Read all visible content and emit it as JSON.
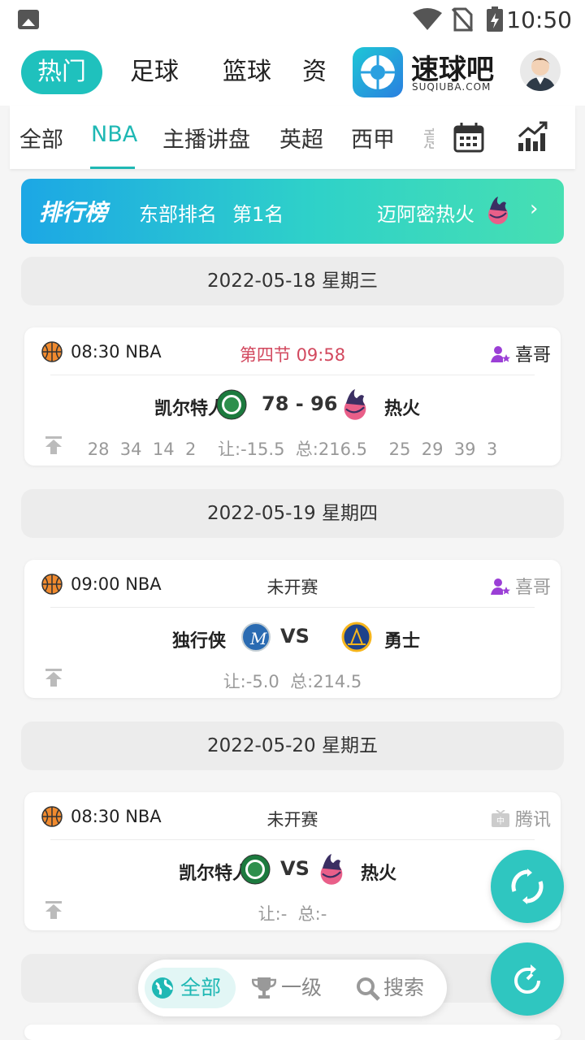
{
  "status_bar": {
    "time": "10:50"
  },
  "top_tabs": [
    {
      "label": "热门",
      "active": true
    },
    {
      "label": "足球",
      "active": false
    },
    {
      "label": "篮球",
      "active": false
    },
    {
      "label": "资讯",
      "active": false
    }
  ],
  "logo": {
    "name": "速球吧",
    "sub": "SUQIUBA.COM"
  },
  "sub_tabs": [
    {
      "label": "全部",
      "active": false
    },
    {
      "label": "NBA",
      "active": true
    },
    {
      "label": "主播讲盘",
      "active": false
    },
    {
      "label": "英超",
      "active": false
    },
    {
      "label": "西甲",
      "active": false
    },
    {
      "label": "意",
      "active": false
    }
  ],
  "banner": {
    "title": "排行榜",
    "conference": "东部排名",
    "rank": "第1名",
    "team": "迈阿密热火",
    "chevron": "›"
  },
  "days": [
    {
      "date": "2022-05-18 星期三",
      "match": {
        "time_league": "08:30 NBA",
        "status": "第四节  09:58",
        "live": true,
        "anchor": "喜哥",
        "anchor_icon": "user-star-icon",
        "home": "凯尔特人",
        "center": "78 - 96",
        "away": "热火",
        "stats": "28  34  14  2    让:-15.5  总:216.5    25  29  39  3"
      }
    },
    {
      "date": "2022-05-19 星期四",
      "match": {
        "time_league": "09:00 NBA",
        "status": "未开赛",
        "live": false,
        "anchor": "喜哥",
        "anchor_icon": "user-star-icon",
        "home": "独行侠",
        "center": "VS",
        "away": "勇士",
        "stats": "让:-5.0  总:214.5"
      }
    },
    {
      "date": "2022-05-20 星期五",
      "match": {
        "time_league": "08:30 NBA",
        "status": "未开赛",
        "live": false,
        "anchor": "腾讯",
        "anchor_icon": "tv-icon",
        "home": "凯尔特人",
        "center": "VS",
        "away": "热火",
        "stats": "让:-  总:-"
      }
    }
  ],
  "bottom_bar": [
    {
      "label": "全部",
      "icon": "globe-icon",
      "active": true
    },
    {
      "label": "一级",
      "icon": "trophy-icon",
      "active": false
    },
    {
      "label": "搜索",
      "icon": "search-icon",
      "active": false
    }
  ],
  "colors": {
    "accent": "#1fc1bd",
    "live": "#d2485e",
    "anchor_icon": "#9b3fd6"
  }
}
